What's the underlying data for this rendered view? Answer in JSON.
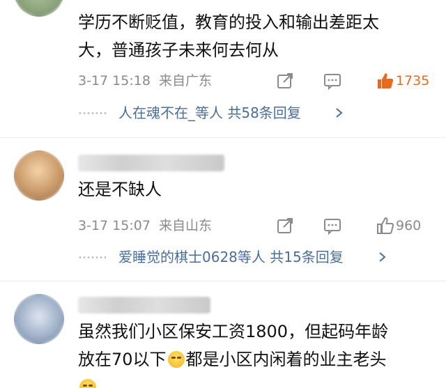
{
  "comments": [
    {
      "text_line1": "学历不断贬值，教育的投入和输出差距太",
      "text_line2": "大，普通孩子未来何去何从",
      "time": "3-17 15:18",
      "location": "来自广东",
      "likes": "1735",
      "liked": true,
      "replies": "人在魂不在_等人  共58条回复"
    },
    {
      "text_line1": "还是不缺人",
      "time": "3-17 15:07",
      "location": "来自山东",
      "likes": "960",
      "liked": false,
      "replies": "爱睡觉的棋士0628等人  共15条回复"
    },
    {
      "text_line1": "虽然我们小区保安工资1800，但起码年龄",
      "text_line2a": "放在70以下",
      "text_line2b": "都是小区内闲着的业主老头"
    }
  ],
  "icons": {
    "share": "share-icon",
    "comment": "comment-icon",
    "like": "thumbs-up-icon",
    "chevron": "chevron-right-icon",
    "emoji": "laugh-cry-emoji-icon"
  },
  "colors": {
    "liked": "#e86a1f",
    "link": "#4a6e9a",
    "meta": "#8a8a8a"
  }
}
